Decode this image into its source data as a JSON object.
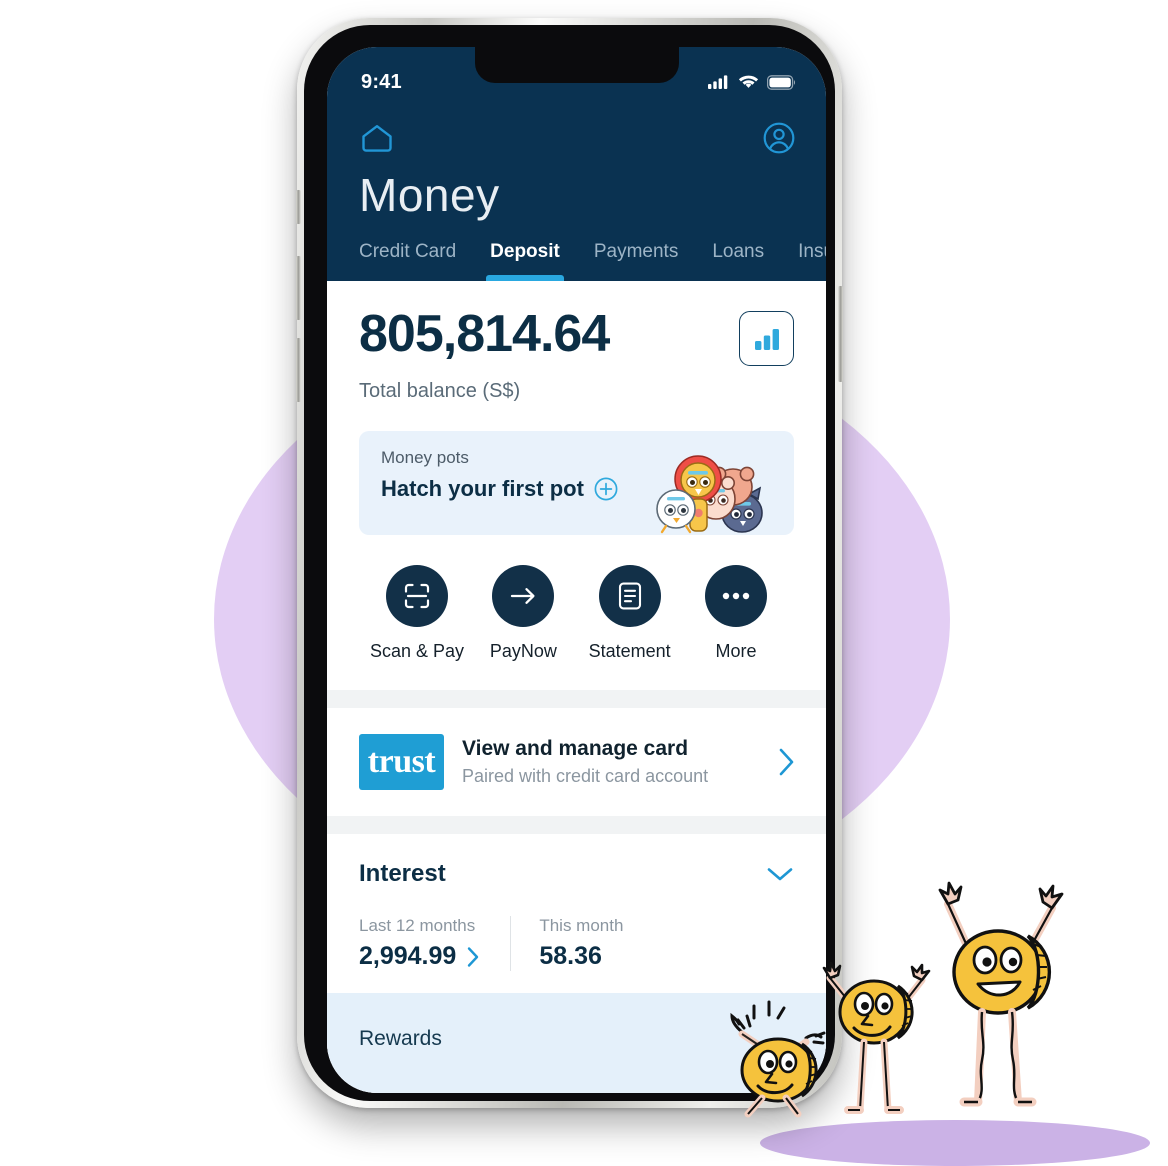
{
  "status_bar": {
    "time": "9:41",
    "icons": [
      "cellular-signal-icon",
      "wifi-icon",
      "battery-icon"
    ]
  },
  "header": {
    "home_icon": "home-icon",
    "profile_icon": "profile-icon",
    "title": "Money",
    "background_color": "#0a3251",
    "accent_color": "#29a8e0"
  },
  "tabs": [
    {
      "label": "Credit Card",
      "active": false
    },
    {
      "label": "Deposit",
      "active": true
    },
    {
      "label": "Payments",
      "active": false
    },
    {
      "label": "Loans",
      "active": false
    },
    {
      "label": "Insurance",
      "active": false
    }
  ],
  "balance": {
    "amount": "805,814.64",
    "label": "Total balance (S$)",
    "chart_button_icon": "bar-chart-icon"
  },
  "money_pots": {
    "label": "Money pots",
    "cta": "Hatch your first pot",
    "add_icon": "plus-circle-icon",
    "art": "money-pot-animals-illustration",
    "background_color": "#e9f2fb"
  },
  "actions": [
    {
      "label": "Scan & Pay",
      "icon": "scan-qr-icon"
    },
    {
      "label": "PayNow",
      "icon": "arrow-right-icon"
    },
    {
      "label": "Statement",
      "icon": "document-icon"
    },
    {
      "label": "More",
      "icon": "ellipsis-icon"
    }
  ],
  "card_row": {
    "logo_text": "trust",
    "logo_color": "#1f9ed4",
    "title": "View and manage card",
    "subtitle": "Paired with credit card account",
    "chevron_icon": "chevron-right-icon"
  },
  "interest": {
    "title": "Interest",
    "collapse_icon": "chevron-down-icon",
    "stats": [
      {
        "label": "Last 12 months",
        "value": "2,994.99",
        "chevron_icon": "chevron-right-icon"
      },
      {
        "label": "This month",
        "value": "58.36"
      }
    ]
  },
  "rewards": {
    "title": "Rewards",
    "background_color": "#e4f0fa"
  },
  "decorations": {
    "circle_color": "#e3cef4",
    "ground_color": "#cbb2e6",
    "mascots": [
      "coin-mascot-jumping",
      "coin-mascot-waving",
      "coin-mascot-cheering"
    ]
  }
}
